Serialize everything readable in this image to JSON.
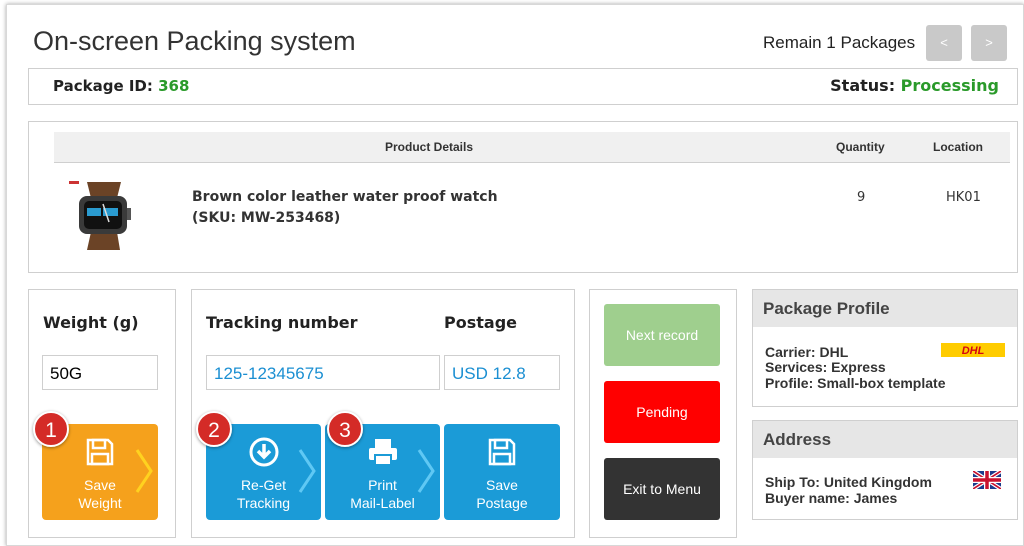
{
  "header": {
    "title": "On-screen Packing system",
    "remain": "Remain 1 Packages",
    "prev_label": "<",
    "next_label": ">"
  },
  "package": {
    "id_label": "Package ID:",
    "id_value": "368",
    "status_label": "Status:",
    "status_value": "Processing"
  },
  "products": {
    "columns": [
      "Product Details",
      "Quantity",
      "Location"
    ],
    "rows": [
      {
        "image": "watch-image",
        "name": "Brown color leather water proof watch",
        "sku": "(SKU: MW-253468)",
        "quantity": "9",
        "location": "HK01"
      }
    ]
  },
  "weight": {
    "label": "Weight (g)",
    "value": "50G",
    "save_line1": "Save",
    "save_line2": "Weight",
    "step": "1"
  },
  "tracking": {
    "label": "Tracking number",
    "value": "125-12345675",
    "postage_label": "Postage",
    "postage_value": "USD 12.8",
    "reget_line1": "Re-Get",
    "reget_line2": "Tracking",
    "reget_step": "2",
    "print_line1": "Print",
    "print_line2": "Mail-Label",
    "print_step": "3",
    "save_line1": "Save",
    "save_line2": "Postage"
  },
  "actions": {
    "next_record": "Next record",
    "pending": "Pending",
    "exit": "Exit to Menu"
  },
  "profile": {
    "title": "Package Profile",
    "carrier": "Carrier: DHL",
    "services": "Services: Express",
    "profile": "Profile: Small-box template",
    "carrier_logo_text": "DHL"
  },
  "address": {
    "title": "Address",
    "ship_to": "Ship To: United Kingdom",
    "buyer": "Buyer name: James",
    "flag": "uk-flag-icon"
  },
  "colors": {
    "orange": "#f5a11c",
    "blue": "#1b9bd7",
    "green_button": "#9fcf8e",
    "red_button": "#ff0000",
    "dark_button": "#333333",
    "status_green": "#2a9a2a",
    "badge_red": "#d42b27"
  }
}
